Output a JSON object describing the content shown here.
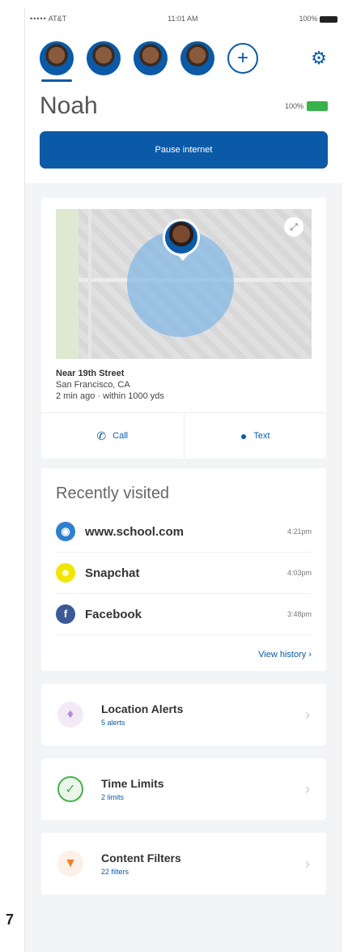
{
  "status_bar": {
    "signal": "•••••",
    "carrier": "AT&T",
    "time": "11:01 AM",
    "battery": "100%"
  },
  "profile": {
    "name": "Noah",
    "battery_percent": "100%",
    "pause_label": "Pause internet"
  },
  "location": {
    "street": "Near 19th Street",
    "city": "San Francisco, CA",
    "updated": "2 min ago · within 1000 yds",
    "call_label": "Call",
    "text_label": "Text"
  },
  "recently_visited": {
    "title": "Recently visited",
    "items": [
      {
        "label": "www.school.com",
        "time": "4:21pm",
        "icon": "globe-icon",
        "color": "#2f7fd0"
      },
      {
        "label": "Snapchat",
        "time": "4:03pm",
        "icon": "snapchat-icon",
        "color": "#f2e600"
      },
      {
        "label": "Facebook",
        "time": "3:48pm",
        "icon": "facebook-icon",
        "color": "#3b5998"
      }
    ],
    "view_history": "View history  ›"
  },
  "features": [
    {
      "title": "Location Alerts",
      "subtitle": "5 alerts",
      "icon": "lightbulb-icon",
      "color": "#b58ad6",
      "icon_bg": "#f3eaf8"
    },
    {
      "title": "Time Limits",
      "subtitle": "2 limits",
      "icon": "clock-icon",
      "color": "#48b24a",
      "icon_bg": "#eaf6ea"
    },
    {
      "title": "Content Filters",
      "subtitle": "22 filters",
      "icon": "filter-icon",
      "color": "#f07f2a",
      "icon_bg": "#fdf0e6"
    }
  ],
  "page_number": "7"
}
